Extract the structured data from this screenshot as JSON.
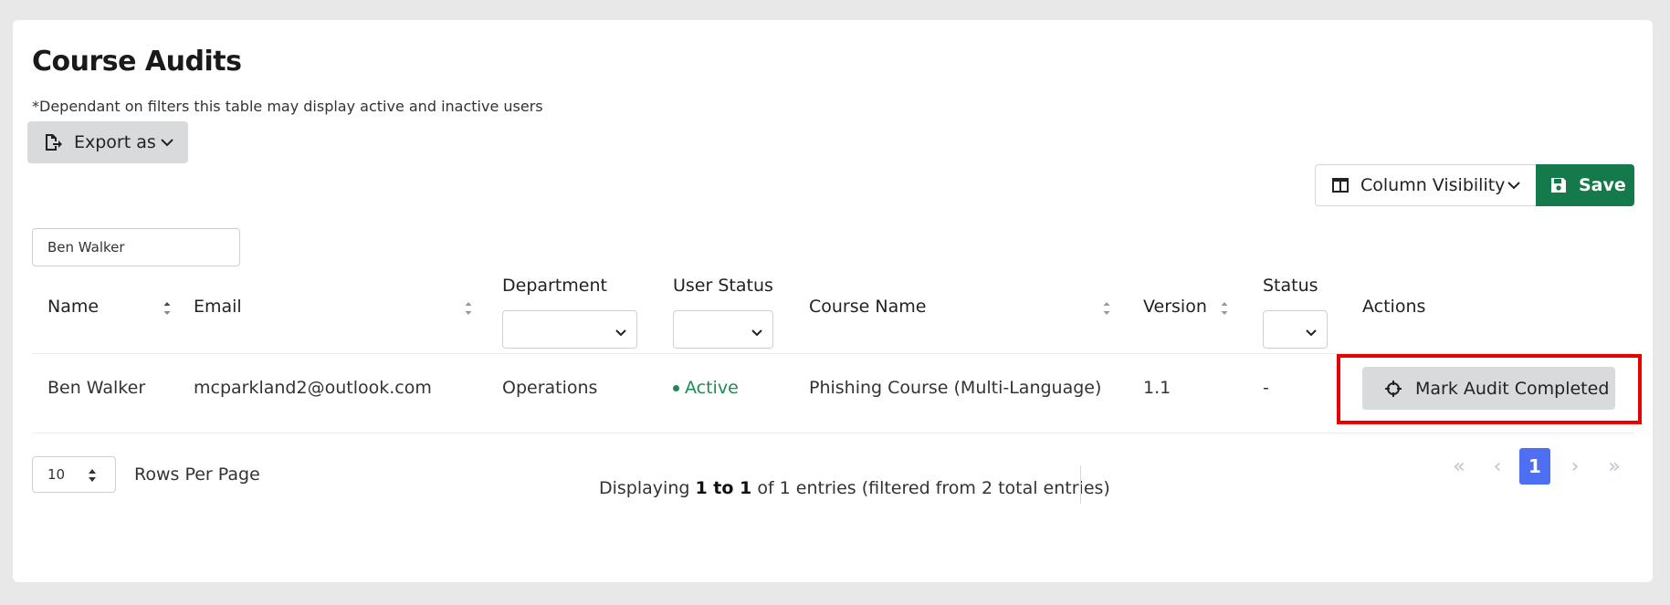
{
  "page": {
    "title": "Course Audits",
    "subtitle": "*Dependant on filters this table may display active and inactive users"
  },
  "toolbar": {
    "export_label": "Export as",
    "column_visibility_label": "Column Visibility",
    "save_label": "Save"
  },
  "search": {
    "value": "Ben Walker"
  },
  "table": {
    "columns": [
      "Name",
      "Email",
      "Department",
      "User Status",
      "Course Name",
      "Version",
      "Status",
      "Actions"
    ],
    "rows": [
      {
        "name": "Ben Walker",
        "email": "mcparkland2@outlook.com",
        "department": "Operations",
        "user_status": "Active",
        "course_name": "Phishing Course (Multi-Language)",
        "version": "1.1",
        "status": "-",
        "action_label": "Mark Audit Completed"
      }
    ]
  },
  "footer": {
    "rows_per_page_value": "10",
    "rows_per_page_label": "Rows Per Page",
    "summary_prefix": "Displaying ",
    "summary_range": "1 to 1",
    "summary_suffix": " of 1 entries (filtered from 2 total entries)",
    "pagination": {
      "first": "«",
      "prev": "‹",
      "current": "1",
      "next": "›",
      "last": "»"
    }
  },
  "colors": {
    "save_button": "#147a4c",
    "active_status": "#1f8a55",
    "current_page": "#4f6ff2",
    "highlight": "#e60000"
  },
  "icons": {
    "export": "file-export-icon",
    "column_visibility": "columns-icon",
    "save": "floppy-disk-icon",
    "mark_audit": "crosshair-icon",
    "sort": "sort-icon",
    "dropdown": "chevron-down-icon"
  }
}
